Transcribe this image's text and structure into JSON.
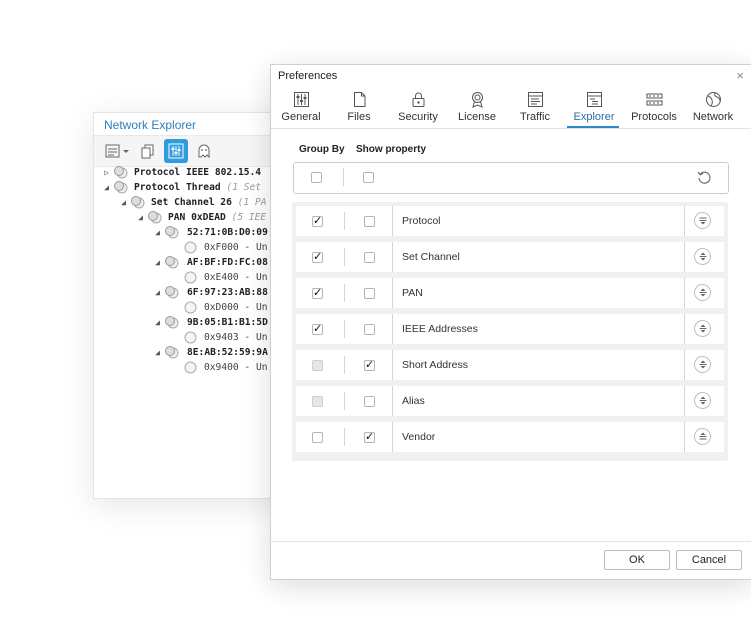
{
  "explorer": {
    "title": "Network Explorer",
    "tree": [
      {
        "label": "Protocol IEEE 802.15.4",
        "meta": "",
        "expanded": false
      },
      {
        "label": "Protocol Thread",
        "meta": "(1 Set",
        "expanded": true
      },
      {
        "label": "Set Channel 26",
        "meta": "(1 PA",
        "expanded": true
      },
      {
        "label": "PAN 0xDEAD",
        "meta": "(5 IEE",
        "expanded": true
      },
      {
        "label": "52:71:0B:D0:09",
        "meta": "",
        "expanded": true
      },
      {
        "value": "0xF000 - Un"
      },
      {
        "label": "AF:BF:FD:FC:08",
        "meta": "",
        "expanded": true
      },
      {
        "value": "0xE400 - Un"
      },
      {
        "label": "6F:97:23:AB:88",
        "meta": "",
        "expanded": true
      },
      {
        "value": "0xD000 - Un"
      },
      {
        "label": "9B:05:B1:B1:5D",
        "meta": "",
        "expanded": true
      },
      {
        "value": "0x9403 - Un"
      },
      {
        "label": "8E:AB:52:59:9A",
        "meta": "",
        "expanded": true
      },
      {
        "value": "0x9400 - Un"
      }
    ]
  },
  "dialog": {
    "title": "Preferences",
    "close": "×",
    "tabs": [
      {
        "label": "General",
        "icon": "sliders-icon"
      },
      {
        "label": "Files",
        "icon": "file-icon"
      },
      {
        "label": "Security",
        "icon": "lock-icon"
      },
      {
        "label": "License",
        "icon": "badge-icon"
      },
      {
        "label": "Traffic",
        "icon": "traffic-icon"
      },
      {
        "label": "Explorer",
        "icon": "explorer-icon",
        "selected": true
      },
      {
        "label": "Protocols",
        "icon": "protocols-icon"
      },
      {
        "label": "Network",
        "icon": "globe-icon"
      }
    ],
    "columns": {
      "group_by": "Group By",
      "show_property": "Show property"
    },
    "properties": [
      {
        "name": "Protocol",
        "group_by": true,
        "group_by_disabled": false,
        "show": false,
        "sort": "descending"
      },
      {
        "name": "Set Channel",
        "group_by": true,
        "group_by_disabled": false,
        "show": false,
        "sort": "both"
      },
      {
        "name": "PAN",
        "group_by": true,
        "group_by_disabled": false,
        "show": false,
        "sort": "both"
      },
      {
        "name": "IEEE Addresses",
        "group_by": true,
        "group_by_disabled": false,
        "show": false,
        "sort": "both"
      },
      {
        "name": "Short Address",
        "group_by": false,
        "group_by_disabled": true,
        "show": true,
        "sort": "both"
      },
      {
        "name": "Alias",
        "group_by": false,
        "group_by_disabled": true,
        "show": false,
        "sort": "both"
      },
      {
        "name": "Vendor",
        "group_by": false,
        "group_by_disabled": false,
        "show": true,
        "sort": "ascending"
      }
    ],
    "ok_label": "OK",
    "cancel_label": "Cancel"
  },
  "colors": {
    "accent": "#2f87c8",
    "explorer_title": "#2f7fc1",
    "toolbar_active": "#2f9be0"
  }
}
